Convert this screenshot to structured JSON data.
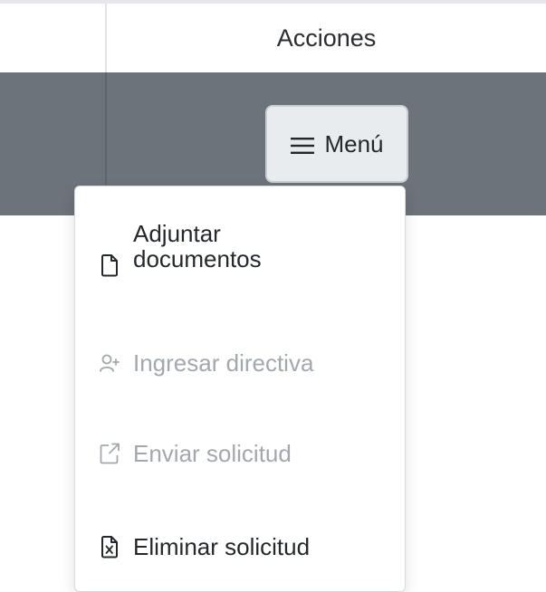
{
  "table": {
    "header_acciones": "Acciones"
  },
  "menu_button": {
    "label": "Menú",
    "icon": "hamburger-icon"
  },
  "dropdown": {
    "items": [
      {
        "label_line1": "Adjuntar",
        "label_line2": "documentos",
        "icon": "file-icon",
        "state": "enabled"
      },
      {
        "label": "Ingresar directiva",
        "icon": "user-plus-icon",
        "state": "disabled"
      },
      {
        "label": "Enviar solicitud",
        "icon": "external-link-icon",
        "state": "disabled"
      },
      {
        "label": "Eliminar solicitud",
        "icon": "file-excel-icon",
        "state": "enabled"
      }
    ]
  },
  "colors": {
    "row_background": "#6d737a",
    "button_background": "#e9ecef",
    "text_enabled": "#24282c",
    "text_disabled": "#a3a8ae"
  }
}
